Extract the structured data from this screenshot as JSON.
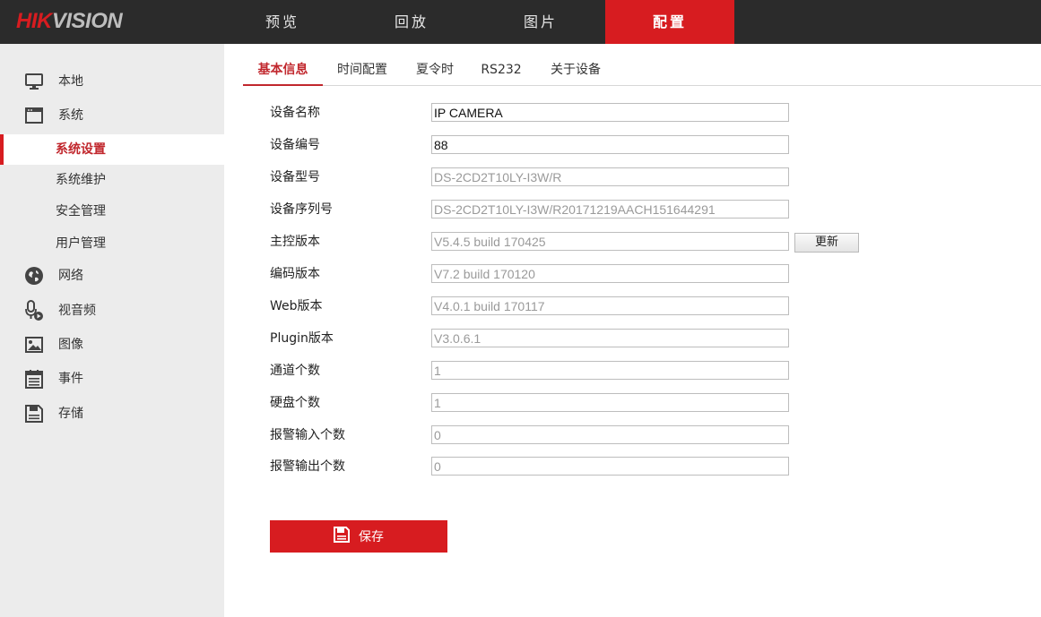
{
  "brand": {
    "part1": "HIK",
    "part2": "VISION"
  },
  "nav": {
    "items": [
      {
        "label": "预览"
      },
      {
        "label": "回放"
      },
      {
        "label": "图片"
      },
      {
        "label": "配置"
      }
    ],
    "active_index": 3
  },
  "sidebar": {
    "items": [
      {
        "label": "本地",
        "icon": "monitor-icon"
      },
      {
        "label": "系统",
        "icon": "system-window-icon"
      },
      {
        "label": "系统设置",
        "sub": true,
        "active": true
      },
      {
        "label": "系统维护",
        "sub": true
      },
      {
        "label": "安全管理",
        "sub": true
      },
      {
        "label": "用户管理",
        "sub": true
      },
      {
        "label": "网络",
        "icon": "globe-icon"
      },
      {
        "label": "视音频",
        "icon": "microphone-icon"
      },
      {
        "label": "图像",
        "icon": "image-icon"
      },
      {
        "label": "事件",
        "icon": "calendar-icon"
      },
      {
        "label": "存储",
        "icon": "storage-icon"
      }
    ]
  },
  "tabs": [
    {
      "label": "基本信息",
      "active": true
    },
    {
      "label": "时间配置"
    },
    {
      "label": "夏令时"
    },
    {
      "label": "RS232"
    },
    {
      "label": "关于设备"
    }
  ],
  "form": {
    "fields": [
      {
        "label": "设备名称",
        "value": "IP CAMERA",
        "editable": true
      },
      {
        "label": "设备编号",
        "value": "88",
        "editable": true
      },
      {
        "label": "设备型号",
        "value": "DS-2CD2T10LY-I3W/R",
        "editable": false
      },
      {
        "label": "设备序列号",
        "value": "DS-2CD2T10LY-I3W/R20171219AACH151644291",
        "editable": false
      },
      {
        "label": "主控版本",
        "value": "V5.4.5 build 170425",
        "editable": false
      },
      {
        "label": "编码版本",
        "value": "V7.2 build 170120",
        "editable": false
      },
      {
        "label": "Web版本",
        "value": "V4.0.1 build 170117",
        "editable": false
      },
      {
        "label": "Plugin版本",
        "value": "V3.0.6.1",
        "editable": false
      },
      {
        "label": "通道个数",
        "value": "1",
        "editable": false
      },
      {
        "label": "硬盘个数",
        "value": "1",
        "editable": false
      },
      {
        "label": "报警输入个数",
        "value": "0",
        "editable": false
      },
      {
        "label": "报警输出个数",
        "value": "0",
        "editable": false
      }
    ],
    "update_label": "更新",
    "save_label": "保存"
  },
  "colors": {
    "accent": "#d71c20",
    "topbar": "#2b2b2b",
    "sidebar": "#ececec"
  }
}
